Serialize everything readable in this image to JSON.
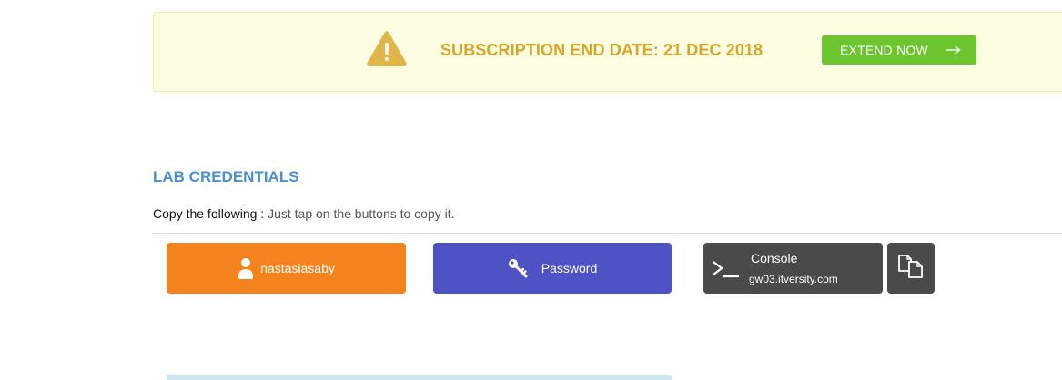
{
  "banner": {
    "text": "SUBSCRIPTION END DATE: 21 DEC 2018",
    "icon": "warning-icon",
    "button_label": "EXTEND NOW",
    "button_icon": "arrow-right-icon",
    "text_color": "#d6a52a",
    "button_color": "#6cc42e",
    "background": "#fdfde1"
  },
  "lab": {
    "title": "LAB CREDENTIALS",
    "instruction_strong": "Copy the following :",
    "instruction_rest": " Just tap on the buttons to copy it.",
    "username": {
      "label": "nastasiasaby",
      "icon": "user-icon",
      "color": "#f5831d"
    },
    "password": {
      "label": "Password",
      "icon": "key-icon",
      "color": "#4f52c4"
    },
    "console": {
      "title": "Console",
      "host": "gw03.itversity.com",
      "icon": "terminal-icon",
      "color": "#4a4a4a"
    },
    "copy": {
      "icon": "copy-icon"
    }
  }
}
